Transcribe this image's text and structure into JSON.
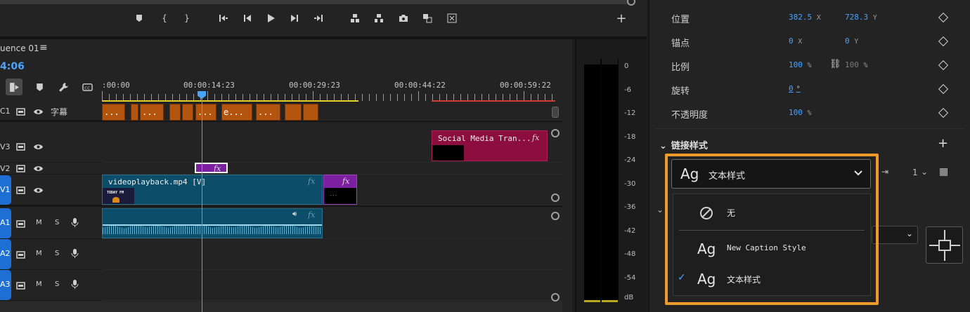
{
  "sequence": {
    "tab_label": "uence 01",
    "menu_icon": "hamburger-icon",
    "timecode": "4:06"
  },
  "ruler": {
    "labels": [
      ":00:00",
      "00:00:14:23",
      "00:00:29:23",
      "00:00:44:22",
      "00:00:59:22"
    ]
  },
  "tracks": {
    "c1": {
      "label": "C1",
      "name": "字幕"
    },
    "v3": {
      "label": "V3"
    },
    "v2": {
      "label": "V2"
    },
    "v1": {
      "label": "V1"
    },
    "a1": {
      "label": "A1",
      "m": "M",
      "s": "S"
    },
    "a2": {
      "label": "A2",
      "m": "M",
      "s": "S"
    },
    "a3": {
      "label": "A3",
      "m": "M",
      "s": "S"
    }
  },
  "clips": {
    "caption_texts": [
      "...",
      "...",
      "...",
      "e...",
      "..."
    ],
    "v3_clip": "Social Media Tran...",
    "v1_clip": "videoplayback.mp4 [V]",
    "v1_thumb": "TODAY FM",
    "fx": "fx",
    "small_clip_text": "..."
  },
  "meter": {
    "labels": [
      "0",
      "-6",
      "-12",
      "-18",
      "-24",
      "-30",
      "-36",
      "-42",
      "-48",
      "-54",
      "dB"
    ]
  },
  "properties": {
    "position": {
      "label": "位置",
      "x": "382.5",
      "x_unit": "X",
      "y": "728.3",
      "y_unit": "Y"
    },
    "anchor": {
      "label": "锚点",
      "x": "0",
      "x_unit": "X",
      "y": "0",
      "y_unit": "Y"
    },
    "scale": {
      "label": "比例",
      "value": "100",
      "unit": "%",
      "value2": "100",
      "unit2": "%"
    },
    "rotation": {
      "label": "旋转",
      "value": "0",
      "unit": "°"
    },
    "opacity": {
      "label": "不透明度",
      "value": "100",
      "unit": "%"
    }
  },
  "linked_styles": {
    "section_title": "链接样式",
    "selected": {
      "ag": "Ag",
      "label": "文本样式"
    },
    "options": [
      {
        "label": "无",
        "icon": "no-style-icon"
      },
      {
        "ag": "Ag",
        "label": "New Caption Style"
      },
      {
        "ag": "Ag",
        "label": "文本样式",
        "checked": true,
        "check": "✓"
      }
    ],
    "count": "1"
  },
  "colors": {
    "accent": "#4aa3ff",
    "highlight": "#f09a2a",
    "caption_clip": "#b3550f",
    "video_clip": "#0c4d6a",
    "fx_clip": "#7c1fa0",
    "title_clip": "#8c0e3f"
  }
}
